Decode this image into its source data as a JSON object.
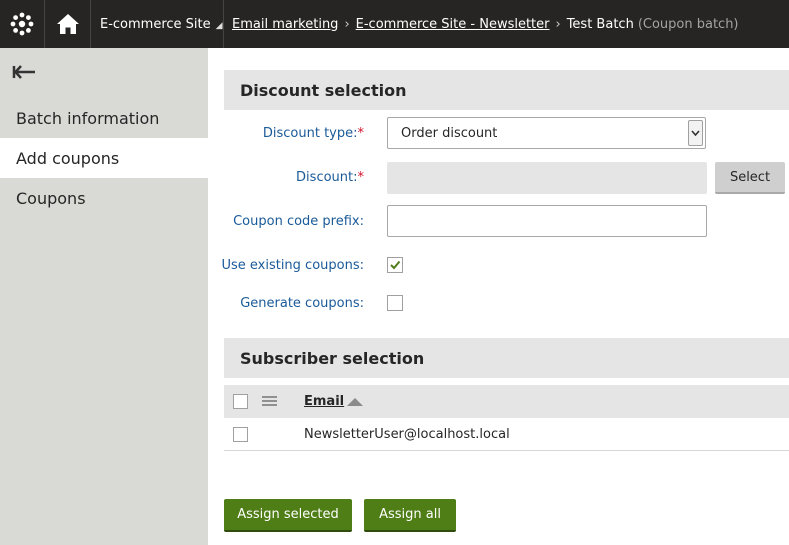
{
  "topbar": {
    "site_name": "E-commerce Site",
    "breadcrumb": {
      "item1": "Email marketing",
      "item2": "E-commerce Site - Newsletter",
      "current": "Test Batch",
      "current_suffix": "(Coupon batch)"
    }
  },
  "sidebar": {
    "items": [
      {
        "label": "Batch information"
      },
      {
        "label": "Add coupons"
      },
      {
        "label": "Coupons"
      }
    ]
  },
  "discount_section": {
    "title": "Discount selection",
    "discount_type_label": "Discount type:",
    "discount_type_value": "Order discount",
    "discount_label": "Discount:",
    "required_mark": "*",
    "select_button": "Select",
    "coupon_prefix_label": "Coupon code prefix:",
    "use_existing_label": "Use existing coupons:",
    "use_existing_checked": true,
    "generate_label": "Generate coupons:",
    "generate_checked": false
  },
  "subscriber_section": {
    "title": "Subscriber selection",
    "grid": {
      "column_email": "Email",
      "rows": [
        {
          "email": "NewsletterUser@localhost.local"
        }
      ]
    }
  },
  "actions": {
    "assign_selected": "Assign selected",
    "assign_all": "Assign all"
  },
  "colors": {
    "topbar_bg": "#262524",
    "sidebar_bg": "#d9dad6",
    "label_blue": "#1a5a99",
    "required_red": "#d0122b",
    "primary_green": "#4f7d16"
  }
}
